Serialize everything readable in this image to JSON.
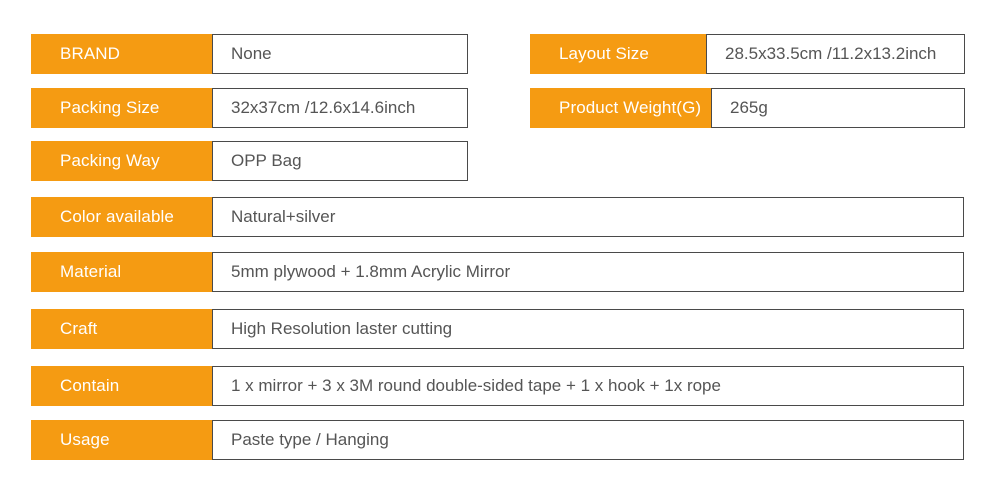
{
  "table": {
    "accent_color": "#F59B12",
    "label_text_color": "#FFFFFF",
    "value_text_color": "#555555",
    "border_color": "#4A4A4A",
    "background_color": "#FFFFFF",
    "left_column": [
      {
        "label": "BRAND",
        "value": "None"
      },
      {
        "label": "Packing Size",
        "value": "32x37cm /12.6x14.6inch"
      },
      {
        "label": "Packing Way",
        "value": "OPP Bag"
      }
    ],
    "right_column": [
      {
        "label": "Layout Size",
        "value": "28.5x33.5cm /11.2x13.2inch"
      },
      {
        "label": "Product Weight(G)",
        "value": "265g"
      }
    ],
    "full_rows": [
      {
        "label": "Color available",
        "value": "Natural+silver"
      },
      {
        "label": "Material",
        "value": "5mm plywood + 1.8mm Acrylic Mirror"
      },
      {
        "label": "Craft",
        "value": "High Resolution laster cutting"
      },
      {
        "label": "Contain",
        "value": "1 x mirror + 3 x 3M round double-sided tape + 1 x hook + 1x rope"
      },
      {
        "label": "Usage",
        "value": "Paste type / Hanging"
      }
    ]
  }
}
